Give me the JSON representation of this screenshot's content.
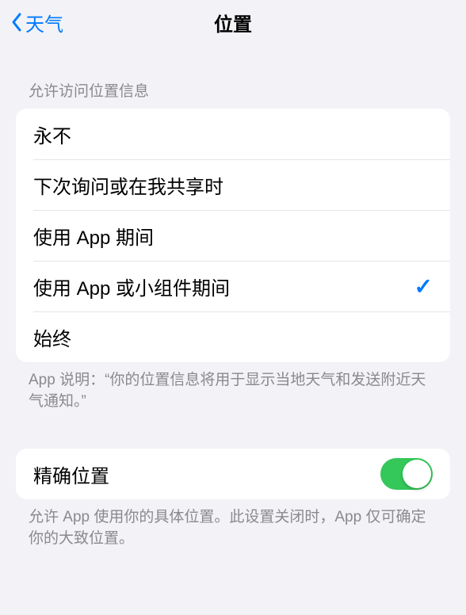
{
  "nav": {
    "back_label": "天气",
    "title": "位置"
  },
  "access_section": {
    "header": "允许访问位置信息",
    "options": [
      {
        "label": "永不",
        "selected": false
      },
      {
        "label": "下次询问或在我共享时",
        "selected": false
      },
      {
        "label": "使用 App 期间",
        "selected": false
      },
      {
        "label": "使用 App 或小组件期间",
        "selected": true
      },
      {
        "label": "始终",
        "selected": false
      }
    ],
    "footer": "App 说明：“你的位置信息将用于显示当地天气和发送附近天气通知。”"
  },
  "precise_section": {
    "label": "精确位置",
    "enabled": true,
    "footer": "允许 App 使用你的具体位置。此设置关闭时，App 仅可确定你的大致位置。"
  }
}
